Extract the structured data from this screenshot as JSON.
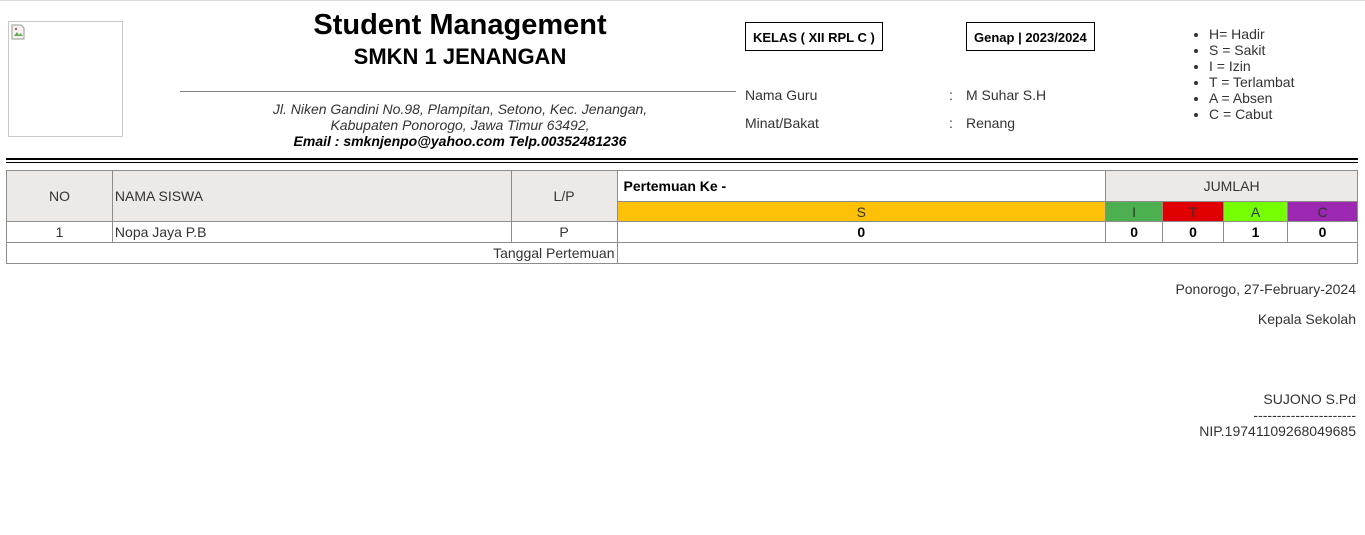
{
  "header": {
    "title": "Student Management",
    "school": "SMKN 1 JENANGAN",
    "address_line1": "Jl. Niken Gandini No.98, Plampitan, Setono, Kec. Jenangan,",
    "address_line2": "Kabupaten Ponorogo, Jawa Timur 63492,",
    "contact": "Email : smknjenpo@yahoo.com Telp.00352481236"
  },
  "class_box": "KELAS ( XII RPL C )",
  "semester_box": "Genap | 2023/2024",
  "info": {
    "teacher_label": "Nama Guru",
    "teacher_value": "M Suhar S.H",
    "interest_label": "Minat/Bakat",
    "interest_value": "Renang",
    "colon": ":"
  },
  "legend": [
    "H= Hadir",
    "S = Sakit",
    "I = Izin",
    "T = Terlambat",
    "A = Absen",
    "C = Cabut"
  ],
  "table": {
    "col_no": "NO",
    "col_name": "NAMA SISWA",
    "col_gender": "L/P",
    "meeting_header": "Pertemuan Ke -",
    "meeting_code": "S",
    "total_header": "JUMLAH",
    "totals": [
      {
        "code": "I",
        "color": "#4caf50"
      },
      {
        "code": "T",
        "color": "#e00000"
      },
      {
        "code": "A",
        "color": "#76ff03"
      },
      {
        "code": "C",
        "color": "#9c27b0"
      }
    ],
    "meeting_color": "#ffc107",
    "rows": [
      {
        "no": "1",
        "name": "Nopa Jaya P.B",
        "gender": "P",
        "meeting": "0",
        "i": "0",
        "t": "0",
        "a": "1",
        "c": "0"
      }
    ],
    "date_label": "Tanggal Pertemuan",
    "date_value": ""
  },
  "signature": {
    "place_date": "Ponorogo, 27-February-2024",
    "role": "Kepala Sekolah",
    "name": "SUJONO S.Pd",
    "dashes": "----------------------",
    "nip": "NIP.19741109268049685"
  }
}
